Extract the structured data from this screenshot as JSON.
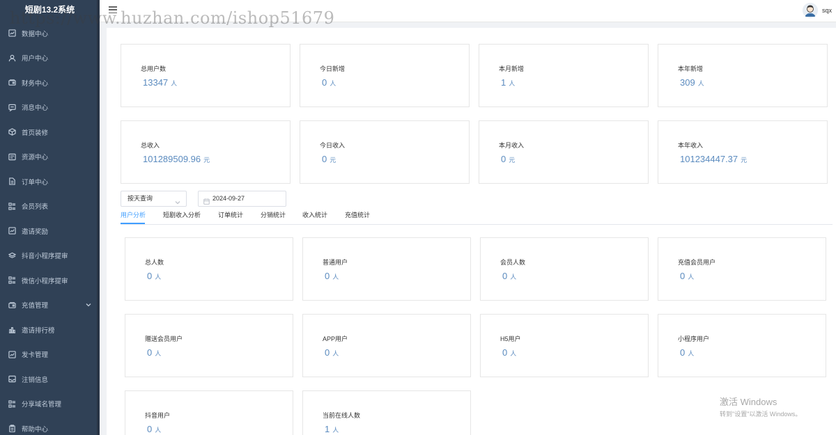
{
  "brand": "短剧13.2系统",
  "watermark": "https://www.huzhan.com/ishop51679",
  "user": {
    "name": "sqx"
  },
  "sidebar": {
    "items": [
      {
        "label": "数据中心",
        "icon": "chart-icon"
      },
      {
        "label": "用户中心",
        "icon": "user-icon"
      },
      {
        "label": "财务中心",
        "icon": "wallet-icon"
      },
      {
        "label": "消息中心",
        "icon": "message-icon"
      },
      {
        "label": "首页装修",
        "icon": "box-icon"
      },
      {
        "label": "资源中心",
        "icon": "resource-icon"
      },
      {
        "label": "订单中心",
        "icon": "document-icon"
      },
      {
        "label": "会员列表",
        "icon": "list-icon"
      },
      {
        "label": "邀请奖励",
        "icon": "chart-icon"
      },
      {
        "label": "抖音小程序提审",
        "icon": "layers-icon"
      },
      {
        "label": "微信小程序提审",
        "icon": "list-icon"
      },
      {
        "label": "充值管理",
        "icon": "wallet-icon"
      },
      {
        "label": "邀请排行榜",
        "icon": "bar-chart-icon"
      },
      {
        "label": "发卡管理",
        "icon": "chart-icon"
      },
      {
        "label": "注销信息",
        "icon": "inbox-icon"
      },
      {
        "label": "分享域名管理",
        "icon": "list-icon"
      },
      {
        "label": "帮助中心",
        "icon": "clipboard-icon"
      }
    ]
  },
  "top_stats": [
    {
      "label": "总用户数",
      "value": "13347",
      "unit": "人"
    },
    {
      "label": "今日新增",
      "value": "0",
      "unit": "人"
    },
    {
      "label": "本月新增",
      "value": "1",
      "unit": "人"
    },
    {
      "label": "本年新增",
      "value": "309",
      "unit": "人"
    },
    {
      "label": "总收入",
      "value": "101289509.96",
      "unit": "元"
    },
    {
      "label": "今日收入",
      "value": "0",
      "unit": "元"
    },
    {
      "label": "本月收入",
      "value": "0",
      "unit": "元"
    },
    {
      "label": "本年收入",
      "value": "101234447.37",
      "unit": "元"
    }
  ],
  "filter": {
    "query_type": "按天查询",
    "date": "2024-09-27"
  },
  "tabs": [
    {
      "label": "用户分析",
      "active": true
    },
    {
      "label": "短剧收入分析",
      "active": false
    },
    {
      "label": "订单统计",
      "active": false
    },
    {
      "label": "分销统计",
      "active": false
    },
    {
      "label": "收入统计",
      "active": false
    },
    {
      "label": "充值统计",
      "active": false
    }
  ],
  "user_stats": [
    {
      "label": "总人数",
      "value": "0",
      "unit": "人"
    },
    {
      "label": "普通用户",
      "value": "0",
      "unit": "人"
    },
    {
      "label": "会员人数",
      "value": "0",
      "unit": "人"
    },
    {
      "label": "充值会员用户",
      "value": "0",
      "unit": "人"
    },
    {
      "label": "赠送会员用户",
      "value": "0",
      "unit": "人"
    },
    {
      "label": "APP用户",
      "value": "0",
      "unit": "人"
    },
    {
      "label": "H5用户",
      "value": "0",
      "unit": "人"
    },
    {
      "label": "小程序用户",
      "value": "0",
      "unit": "人"
    },
    {
      "label": "抖音用户",
      "value": "0",
      "unit": "人"
    },
    {
      "label": "当前在线人数",
      "value": "1",
      "unit": "人"
    }
  ],
  "activation": {
    "title": "激活 Windows",
    "subtitle": "转到\"设置\"以激活 Windows。"
  },
  "colors": {
    "sidebar_bg": "#304156",
    "accent": "#409eff",
    "value_text": "#5b8bbf"
  }
}
